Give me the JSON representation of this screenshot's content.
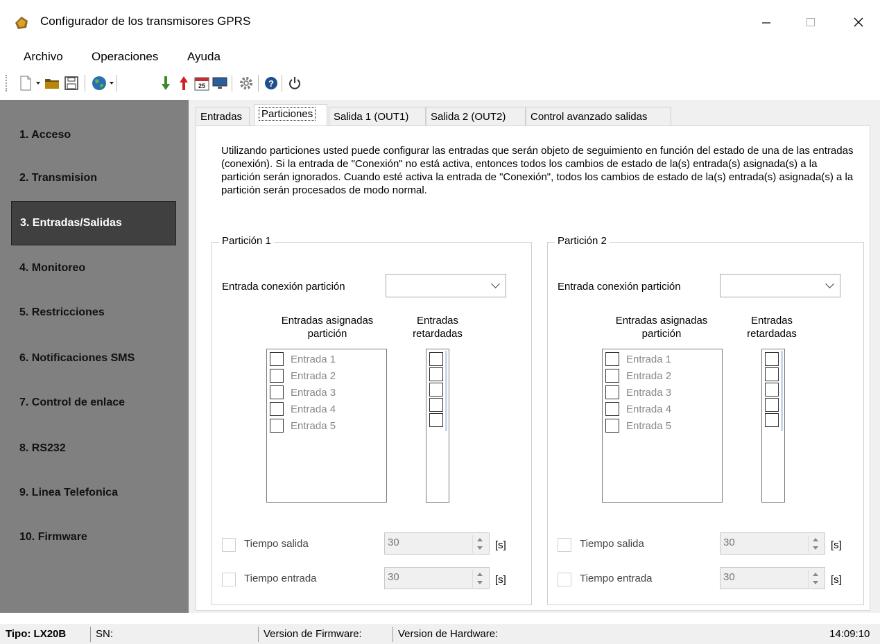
{
  "window": {
    "title": "Configurador de los transmisores GPRS",
    "minimize_icon": "minimize-icon",
    "maximize_icon": "maximize-icon",
    "close_icon": "close-icon"
  },
  "menu": [
    "Archivo",
    "Operaciones",
    "Ayuda"
  ],
  "toolbar": {
    "icons": [
      "new-file-icon",
      "open-folder-icon",
      "save-icon",
      "globe-icon",
      "download-arrow-icon",
      "upload-arrow-icon",
      "calendar-icon",
      "monitor-icon",
      "settings-gear-icon",
      "help-icon",
      "power-icon"
    ],
    "calendar_day": "25"
  },
  "sidebar": {
    "items": [
      "1. Acceso",
      "2. Transmision",
      "3. Entradas/Salidas",
      "4. Monitoreo",
      "5. Restricciones",
      "6. Notificaciones SMS",
      "7. Control de enlace",
      "8. RS232",
      "9. Linea Telefonica",
      "10. Firmware"
    ],
    "active_index": 2
  },
  "tabs": [
    "Entradas",
    "Particiones",
    "Salida 1 (OUT1)",
    "Salida 2 (OUT2)",
    "Control avanzado salidas"
  ],
  "active_tab": "Particiones",
  "description": "Utilizando particiones usted puede configurar las entradas que serán objeto de seguimiento en función del estado de una de las entradas (conexión). Si la entrada de \"Conexión\" no está activa, entonces todos los cambios de estado de la(s) entrada(s) asignada(s) a la partición serán ignorados. Cuando esté activa la entrada de \"Conexión\", todos los cambios de estado de la(s) entrada(s) asignada(s) a la partición serán procesados de modo normal.",
  "partitions": [
    {
      "title": "Partición 1",
      "connection_label": "Entrada conexión partición",
      "connection_value": "",
      "assigned_header": [
        "Entradas asignadas",
        "partición"
      ],
      "delayed_header": [
        "Entradas",
        "retardadas"
      ],
      "inputs": [
        "Entrada 1",
        "Entrada 2",
        "Entrada 3",
        "Entrada 4",
        "Entrada 5"
      ],
      "exit_time_label": "Tiempo salida",
      "exit_time_value": "30",
      "entry_time_label": "Tiempo entrada",
      "entry_time_value": "30",
      "unit": "[s]"
    },
    {
      "title": "Partición 2",
      "connection_label": "Entrada conexión partición",
      "connection_value": "",
      "assigned_header": [
        "Entradas asignadas",
        "partición"
      ],
      "delayed_header": [
        "Entradas",
        "retardadas"
      ],
      "inputs": [
        "Entrada 1",
        "Entrada 2",
        "Entrada 3",
        "Entrada 4",
        "Entrada 5"
      ],
      "exit_time_label": "Tiempo salida",
      "exit_time_value": "30",
      "entry_time_label": "Tiempo entrada",
      "entry_time_value": "30",
      "unit": "[s]"
    }
  ],
  "status": {
    "tipo": "Tipo: LX20B",
    "sn": "SN:",
    "firmware": "Version de Firmware:",
    "hardware": "Version de Hardware:",
    "time": "14:09:10"
  }
}
